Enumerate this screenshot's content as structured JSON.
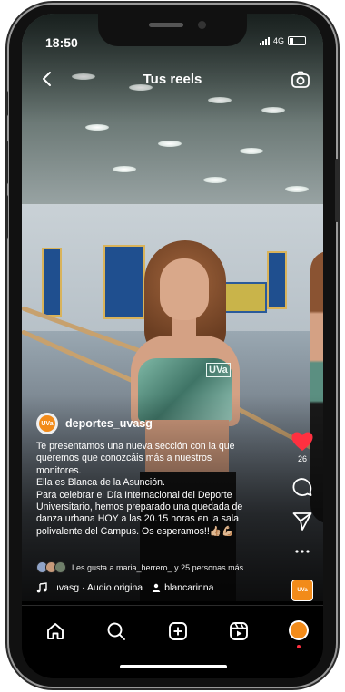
{
  "status_bar": {
    "time": "18:50",
    "network": "4G"
  },
  "header": {
    "title": "Tus reels"
  },
  "post": {
    "username": "deportes_uvasg",
    "avatar_label": "UVa",
    "chest_logo": "UVa",
    "caption_lines": [
      "Te presentamos una nueva sección con la que queremos que conozcáis más a nuestros monitores.",
      "Ella es Blanca de la Asunción.",
      "Para celebrar el Día Internacional del Deporte Universitario, hemos preparado una quedada de danza urbana HOY a las 20.15 horas en la sala polivalente del Campus. Os esperamos!!👍🏼💪🏼"
    ],
    "likes_text": "Les gusta a maria_herrero_ y 25 personas más",
    "audio_text": "ıvasg · Audio origina",
    "tagged_user": "blancarinna",
    "like_count": "26",
    "audio_thumb_label": "UVa"
  },
  "icons": {
    "back": "chevron-left-icon",
    "camera": "camera-icon",
    "like": "heart-icon",
    "comment": "comment-icon",
    "share": "send-icon",
    "more": "more-icon",
    "home": "home-icon",
    "search": "search-icon",
    "create": "plus-square-icon",
    "reels": "reels-icon",
    "profile": "avatar"
  },
  "colors": {
    "like_red": "#ff3040",
    "brand_orange": "#f28b1a"
  }
}
